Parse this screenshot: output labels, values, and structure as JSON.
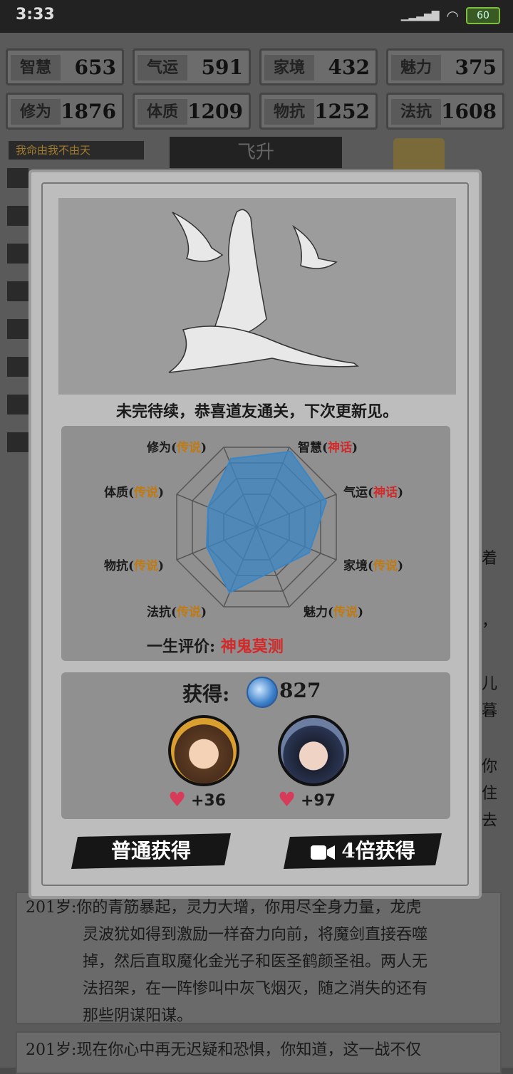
{
  "statusbar": {
    "time": "3:33",
    "battery": "60"
  },
  "stats": [
    {
      "label": "智慧",
      "value": "653"
    },
    {
      "label": "气运",
      "value": "591"
    },
    {
      "label": "家境",
      "value": "432"
    },
    {
      "label": "魅力",
      "value": "375"
    },
    {
      "label": "修为",
      "value": "1876"
    },
    {
      "label": "体质",
      "value": "1209"
    },
    {
      "label": "物抗",
      "value": "1252"
    },
    {
      "label": "法抗",
      "value": "1608"
    }
  ],
  "motto": "我命由我不由天",
  "ascend_tab": "飞升",
  "background_log": {
    "entry1": [
      "201岁:你的青筋暴起，灵力大增，你用尽全身力量，龙虎",
      "灵波犹如得到激励一样奋力向前，将魔剑直接吞噬",
      "掉，然后直取魔化金光子和医圣鹤颜圣祖。两人无",
      "法招架，在一阵惨叫中灰飞烟灭，随之消失的还有",
      "那些阴谋阳谋。"
    ],
    "entry2": "201岁:现在你心中再无迟疑和恐惧，你知道，这一战不仅",
    "right_fragments": [
      "着",
      "，",
      "儿",
      "暮",
      "你",
      "住",
      "去"
    ]
  },
  "dialog": {
    "ending_text": "未完待续，恭喜道友通关，下次更新见。",
    "radar": {
      "attributes": [
        {
          "name": "修为",
          "tier": "传说",
          "tier_color": "#c07a12"
        },
        {
          "name": "智慧",
          "tier": "神话",
          "tier_color": "#d22a2a"
        },
        {
          "name": "体质",
          "tier": "传说",
          "tier_color": "#c07a12"
        },
        {
          "name": "气运",
          "tier": "神话",
          "tier_color": "#d22a2a"
        },
        {
          "name": "物抗",
          "tier": "传说",
          "tier_color": "#c07a12"
        },
        {
          "name": "家境",
          "tier": "传说",
          "tier_color": "#c07a12"
        },
        {
          "name": "法抗",
          "tier": "传说",
          "tier_color": "#c07a12"
        },
        {
          "name": "魅力",
          "tier": "传说",
          "tier_color": "#c07a12"
        }
      ]
    },
    "evaluation": {
      "label": "一生评价:",
      "value": "神鬼莫测"
    },
    "reward": {
      "label": "获得:",
      "amount": "827",
      "companions": [
        {
          "affinity": "+36"
        },
        {
          "affinity": "+97"
        }
      ]
    },
    "buttons": {
      "normal": "普通获得",
      "video": "4倍获得"
    }
  }
}
